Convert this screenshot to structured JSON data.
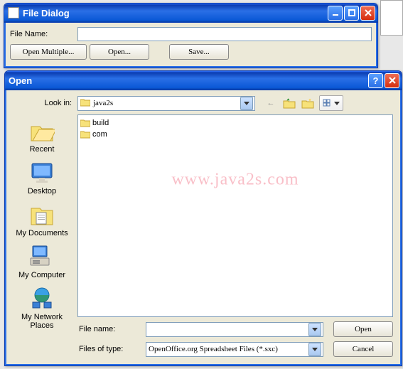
{
  "file_dialog": {
    "title": "File Dialog",
    "file_name_label": "File Name:",
    "file_name_value": "",
    "buttons": {
      "open_multiple": "Open Multiple...",
      "open": "Open...",
      "save": "Save..."
    }
  },
  "open_dialog": {
    "title": "Open",
    "look_in_label": "Look in:",
    "look_in_value": "java2s",
    "sidebar": [
      {
        "label": "Recent"
      },
      {
        "label": "Desktop"
      },
      {
        "label": "My Documents"
      },
      {
        "label": "My Computer"
      },
      {
        "label": "My Network Places"
      }
    ],
    "file_list": [
      {
        "name": "build"
      },
      {
        "name": "com"
      }
    ],
    "watermark": "www.java2s.com",
    "file_name_label": "File name:",
    "file_name_value": "",
    "files_of_type_label": "Files of type:",
    "files_of_type_value": "OpenOffice.org Spreadsheet Files (*.sxc)",
    "open_btn": "Open",
    "cancel_btn": "Cancel"
  }
}
